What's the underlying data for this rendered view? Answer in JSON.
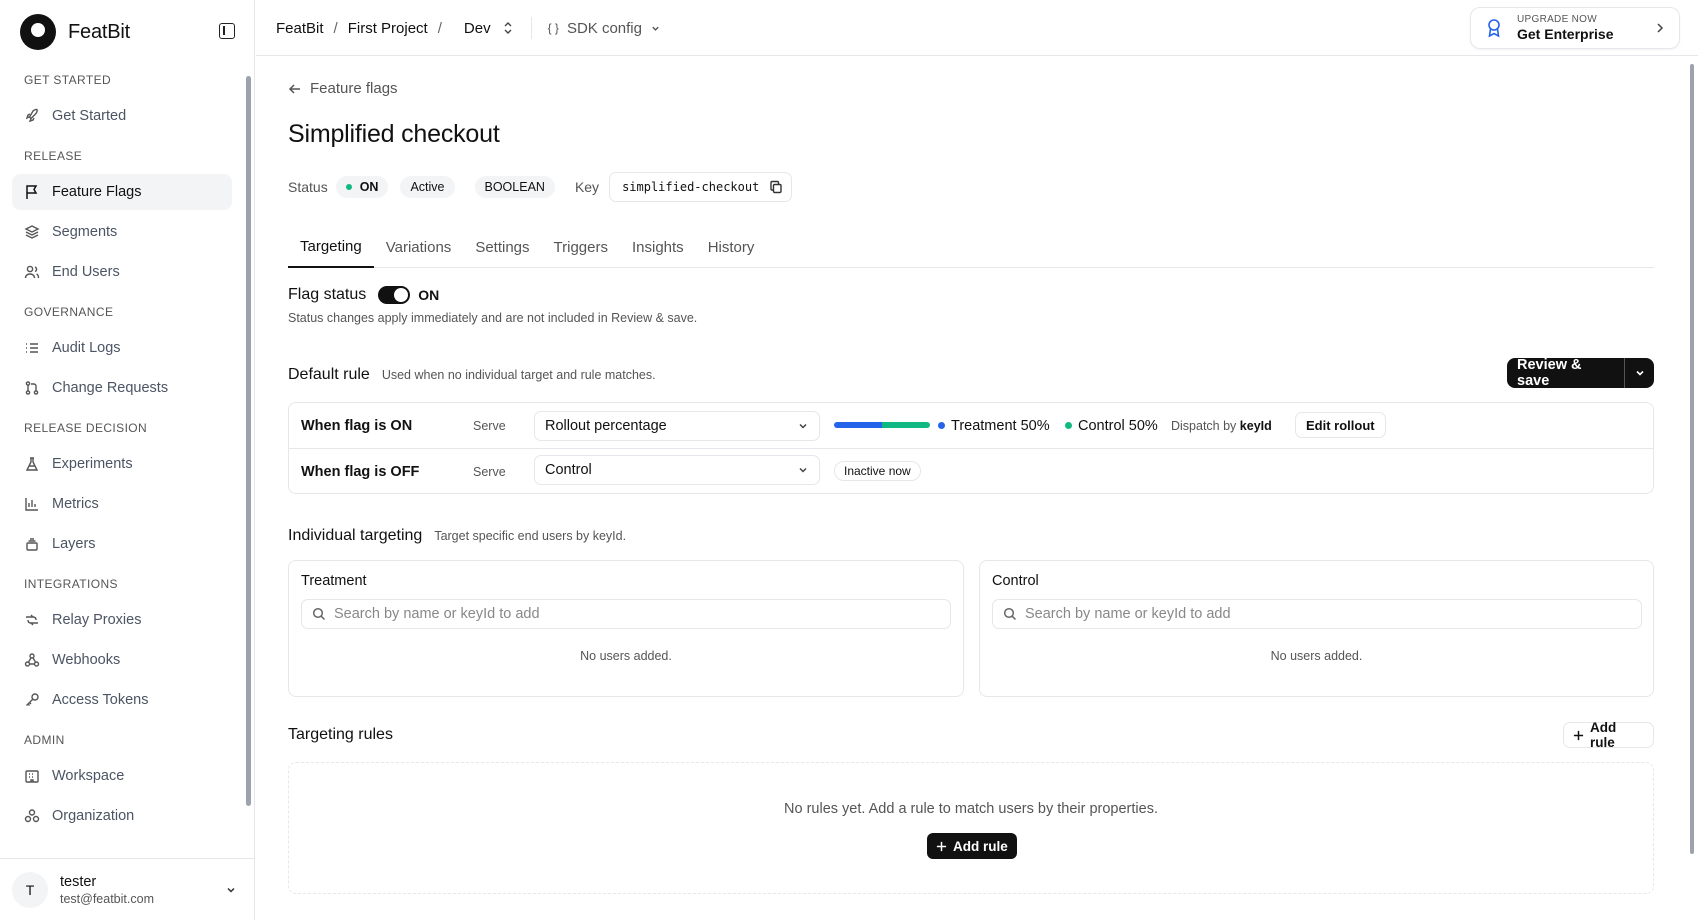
{
  "brand": {
    "name": "FeatBit"
  },
  "sidebar": {
    "sections": [
      {
        "label": "GET STARTED",
        "items": [
          {
            "label": "Get Started",
            "icon": "rocket-icon"
          }
        ]
      },
      {
        "label": "RELEASE",
        "items": [
          {
            "label": "Feature Flags",
            "icon": "flag-icon",
            "active": true
          },
          {
            "label": "Segments",
            "icon": "layers-icon"
          },
          {
            "label": "End Users",
            "icon": "users-icon"
          }
        ]
      },
      {
        "label": "GOVERNANCE",
        "items": [
          {
            "label": "Audit Logs",
            "icon": "list-icon"
          },
          {
            "label": "Change Requests",
            "icon": "git-pull-request-icon"
          }
        ]
      },
      {
        "label": "RELEASE DECISION",
        "items": [
          {
            "label": "Experiments",
            "icon": "flask-icon"
          },
          {
            "label": "Metrics",
            "icon": "bar-chart-icon"
          },
          {
            "label": "Layers",
            "icon": "layers-stack-icon"
          }
        ]
      },
      {
        "label": "INTEGRATIONS",
        "items": [
          {
            "label": "Relay Proxies",
            "icon": "relay-icon"
          },
          {
            "label": "Webhooks",
            "icon": "webhook-icon"
          },
          {
            "label": "Access Tokens",
            "icon": "key-icon"
          }
        ]
      },
      {
        "label": "ADMIN",
        "items": [
          {
            "label": "Workspace",
            "icon": "building-icon"
          },
          {
            "label": "Organization",
            "icon": "organization-icon"
          }
        ]
      }
    ]
  },
  "user": {
    "initial": "T",
    "name": "tester",
    "email": "test@featbit.com"
  },
  "topbar": {
    "crumbs": [
      "FeatBit",
      "First Project"
    ],
    "sep": "/",
    "env": "Dev",
    "sdk_config": "SDK config",
    "sdk_icon_text": "{ }",
    "upgrade_small": "UPGRADE NOW",
    "upgrade_big": "Get Enterprise"
  },
  "page": {
    "back_label": "Feature flags",
    "title": "Simplified checkout",
    "status_label": "Status",
    "status_value": "ON",
    "active_badge": "Active",
    "type_badge": "BOOLEAN",
    "key_label": "Key",
    "key_value": "simplified-checkout"
  },
  "tabs": [
    "Targeting",
    "Variations",
    "Settings",
    "Triggers",
    "Insights",
    "History"
  ],
  "flag_status": {
    "label": "Flag status",
    "value": "ON",
    "hint": "Status changes apply immediately and are not included in Review & save."
  },
  "default_rule": {
    "title": "Default rule",
    "subtitle": "Used when no individual target and rule matches.",
    "review_save": "Review & save",
    "on_row": {
      "label": "When flag is ON",
      "serve": "Serve",
      "select": "Rollout percentage"
    },
    "off_row": {
      "label": "When flag is OFF",
      "serve": "Serve",
      "select": "Control",
      "chip": "Inactive now"
    },
    "rollout": [
      {
        "name": "Treatment",
        "percent": 50,
        "label": "Treatment 50%",
        "color": "#2563eb"
      },
      {
        "name": "Control",
        "percent": 50,
        "label": "Control 50%",
        "color": "#10b981"
      }
    ],
    "dispatch_prefix": "Dispatch by",
    "dispatch_key": "keyId",
    "edit_rollout": "Edit rollout"
  },
  "individual": {
    "title": "Individual targeting",
    "subtitle": "Target specific end users by keyId.",
    "cards": [
      {
        "name": "Treatment",
        "placeholder": "Search by name or keyId to add",
        "empty": "No users added."
      },
      {
        "name": "Control",
        "placeholder": "Search by name or keyId to add",
        "empty": "No users added."
      }
    ]
  },
  "rules": {
    "title": "Targeting rules",
    "add_rule": "Add rule",
    "empty": "No rules yet. Add a rule to match users by their properties.",
    "add_rule_dark": "Add rule"
  }
}
